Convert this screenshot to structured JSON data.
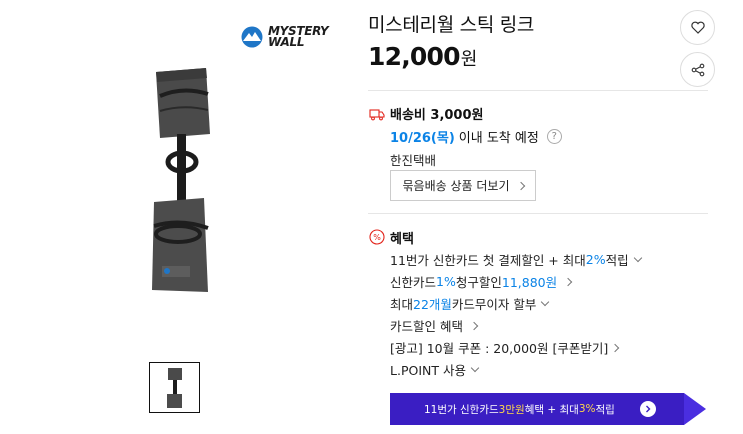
{
  "brand": {
    "name_line1": "MYSTERY",
    "name_line2": "WALL"
  },
  "product": {
    "title": "미스테리월 스틱 링크",
    "price": "12,000",
    "price_unit": "원"
  },
  "actions": {
    "wish_icon": "heart-icon",
    "share_icon": "share-icon"
  },
  "shipping": {
    "title": "배송비 3,000원",
    "date": "10/26(목)",
    "arrival_text": "이내 도착 예정",
    "help": "?",
    "courier": "한진택배",
    "bundle_label": "묶음배송 상품 더보기"
  },
  "benefits": {
    "title": "혜택",
    "row1": {
      "a": "11번가 신한카드 첫 결제할인 + 최대 ",
      "b": "2%",
      "c": " 적립"
    },
    "row2": {
      "a": "신한카드 ",
      "b": "1%",
      "c": " 청구할인 ",
      "d": "11,880원"
    },
    "row3": {
      "a": "최대 ",
      "b": "22개월",
      "c": " 카드무이자 할부"
    },
    "row4": {
      "a": "카드할인 혜택"
    },
    "row5": {
      "a": "[광고] 10월 쿠폰 : 20,000원 [쿠폰받기]"
    },
    "row6": {
      "a": "L.POINT 사용"
    }
  },
  "banner": {
    "a": "11번가 신한카드 ",
    "b": "3만원",
    "c": " 혜택 + 최대 ",
    "d": "3%",
    "e": " 적립",
    "accent": "#3a1ec3"
  }
}
